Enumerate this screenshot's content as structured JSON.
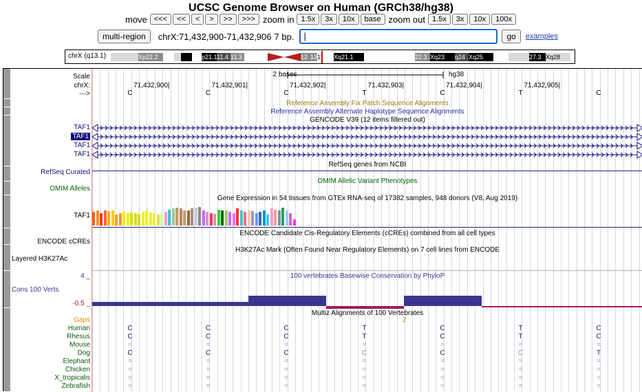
{
  "page_title": "UCSC Genome Browser on Human (GRCh38/hg38)",
  "nav": {
    "move_label": "move",
    "move_buttons": [
      "<<<",
      "<<",
      "<",
      ">",
      ">>",
      ">>>"
    ],
    "zoom_in_label": "zoom in",
    "zoom_in_buttons": [
      "1.5x",
      "3x",
      "10x",
      "base"
    ],
    "zoom_out_label": "zoom out",
    "zoom_out_buttons": [
      "1.5x",
      "3x",
      "10x",
      "100x"
    ]
  },
  "position": {
    "multi_region_label": "multi-region",
    "position_text": "chrX:71,432,900-71,432,906",
    "size_text": "7 bp.",
    "search_value": "|",
    "go_label": "go",
    "examples_label": "examples"
  },
  "ideogram": {
    "chrom_label": "chrX (q13.1)",
    "bands": [
      "Xp22.2",
      "p21.1",
      "11.4",
      "11.3",
      "12",
      "13",
      "1",
      "Xq21.1",
      "22.3",
      "Xq23",
      "q24",
      "Xq25",
      "27.3",
      "Xq28"
    ]
  },
  "ruler": {
    "scale_label": "Scale",
    "chr_label": "chrX:",
    "arrow_label": "--->",
    "scale_text": "2 bases",
    "assembly": "hg38",
    "positions": [
      "71,432,900",
      "71,432,901",
      "71,432,902",
      "71,432,903",
      "71,432,904",
      "71,432,905"
    ],
    "bases": [
      "C",
      "C",
      "C",
      "T",
      "C",
      "T",
      "C"
    ]
  },
  "tracks": {
    "fix_patch": "Reference Assembly Fix Patch Sequence Alignments",
    "alt_haplotype": "Reference Assembly Alternate Haplotype Sequence Alignments",
    "gencode": "GENCODE V39 (12 items filtered out)",
    "gencode_items": [
      "TAF1",
      "TAF1",
      "TAF1",
      "TAF1"
    ],
    "refseq_label": "RefSeq Curated",
    "refseq_title": "RefSeq genes from NCBI",
    "omim_label": "OMIM Alleles",
    "omim_title": "OMIM Allelic Variant Phenotypes",
    "gtex_title": "Gene Expression in 54 tissues from GTEx RNA-seq of 17382 samples, 948 donors (V8, Aug 2019)",
    "gtex_gene": "TAF1",
    "encode_title": "ENCODE Candidate Cis-Regulatory Elements (cCREs) combined from all cell types",
    "encode_label": "ENCODE cCREs",
    "h3k27ac_title": "H3K27Ac Mark (Often Found Near Regulatory Elements) on 7 cell lines from ENCODE",
    "h3k27ac_label": "Layered H3K27Ac",
    "cons_title": "100 vertebrates Basewise Conservation by PhyloP",
    "cons_label": "Cons 100 Verts",
    "cons_max": "4 _",
    "cons_min": "-0.5 _",
    "multiz_title": "Multiz Alignments of 100 Vertebrates",
    "multiz_marker": "2"
  },
  "alignment": {
    "species": [
      "Gaps",
      "Human",
      "Rhesus",
      "Mouse",
      "Dog",
      "Elephant",
      "Chicken",
      "X_tropicalis",
      "Zebrafish"
    ],
    "rows": {
      "Human": [
        "C",
        "C",
        "C",
        "T",
        "C",
        "T",
        "C"
      ],
      "Rhesus": [
        "C",
        "C",
        "C",
        "T",
        "C",
        "T",
        "C"
      ],
      "Mouse": [
        "=",
        "=",
        "=",
        "=",
        "=",
        "=",
        "="
      ],
      "Dog": [
        "C",
        "C",
        "C",
        "C",
        "C",
        "C",
        "T"
      ],
      "Elephant": [
        "=",
        "=",
        "=",
        "=",
        "=",
        "=",
        "="
      ],
      "Chicken": [
        "=",
        "=",
        "=",
        "=",
        "=",
        "=",
        "="
      ],
      "X_tropicalis": [
        "=",
        "=",
        "=",
        "=",
        "=",
        "=",
        "="
      ],
      "Zebrafish": [
        "=",
        "=",
        "=",
        "=",
        "=",
        "=",
        "="
      ]
    }
  },
  "gtex_values": [
    0.55,
    0.6,
    0.5,
    0.62,
    0.58,
    0.6,
    0.45,
    0.5,
    0.55,
    0.5,
    0.52,
    0.5,
    0.48,
    0.55,
    0.6,
    0.52,
    0.5,
    0.45,
    0.5,
    0.55,
    0.65,
    0.7,
    0.72,
    0.7,
    0.62,
    0.6,
    0.7,
    0.72,
    0.75,
    0.6,
    0.55,
    0.5,
    0.48,
    0.65,
    0.6,
    0.6,
    0.55,
    0.5,
    0.7,
    0.6,
    0.55,
    0.62,
    0.58,
    0.5,
    0.55,
    0.6,
    0.45,
    0.7,
    0.65,
    0.6,
    0.72,
    0.6,
    0.5,
    0.25
  ],
  "gtex_colors": [
    "#ff6600",
    "#ff8c1a",
    "#ff3300",
    "#ff6633",
    "#ffaa00",
    "#ffcc00",
    "#ff9933",
    "#ff9933",
    "#eeee00",
    "#eeee00",
    "#dddd00",
    "#dddd00",
    "#ccdd33",
    "#eeee33",
    "#eeee33",
    "#eeee33",
    "#eeee33",
    "#dddd55",
    "#ccff99",
    "#ff99cc",
    "#33cccc",
    "#99cc99",
    "#cc9966",
    "#aa8866",
    "#cc9966",
    "#996633",
    "#aa8888",
    "#cccccc",
    "#888888",
    "#cc66ff",
    "#cc99cc",
    "#ff3366",
    "#cc99aa",
    "#33cc33",
    "#006600",
    "#99cc66",
    "#cc66ff",
    "#ff66ff",
    "#ff3333",
    "#33cccc",
    "#ff6699",
    "#ffcc99",
    "#9999cc",
    "#6699ff",
    "#3366cc",
    "#0099cc",
    "#33ccff",
    "#ff99cc",
    "#ff9999",
    "#669999",
    "#339966",
    "#99ccff",
    "#cc66cc",
    "#ff33ff"
  ],
  "colors": {
    "fix_patch": "#9a7a0c",
    "alt_haplotype": "#2a2aa0",
    "gencode": "#0c0c78",
    "refseq": "#12127a",
    "omim": "#006400",
    "cons": "#3b3591",
    "cons_neg": "#a0185b",
    "gaps": "#e28a00",
    "species": "#0a5a0a"
  }
}
